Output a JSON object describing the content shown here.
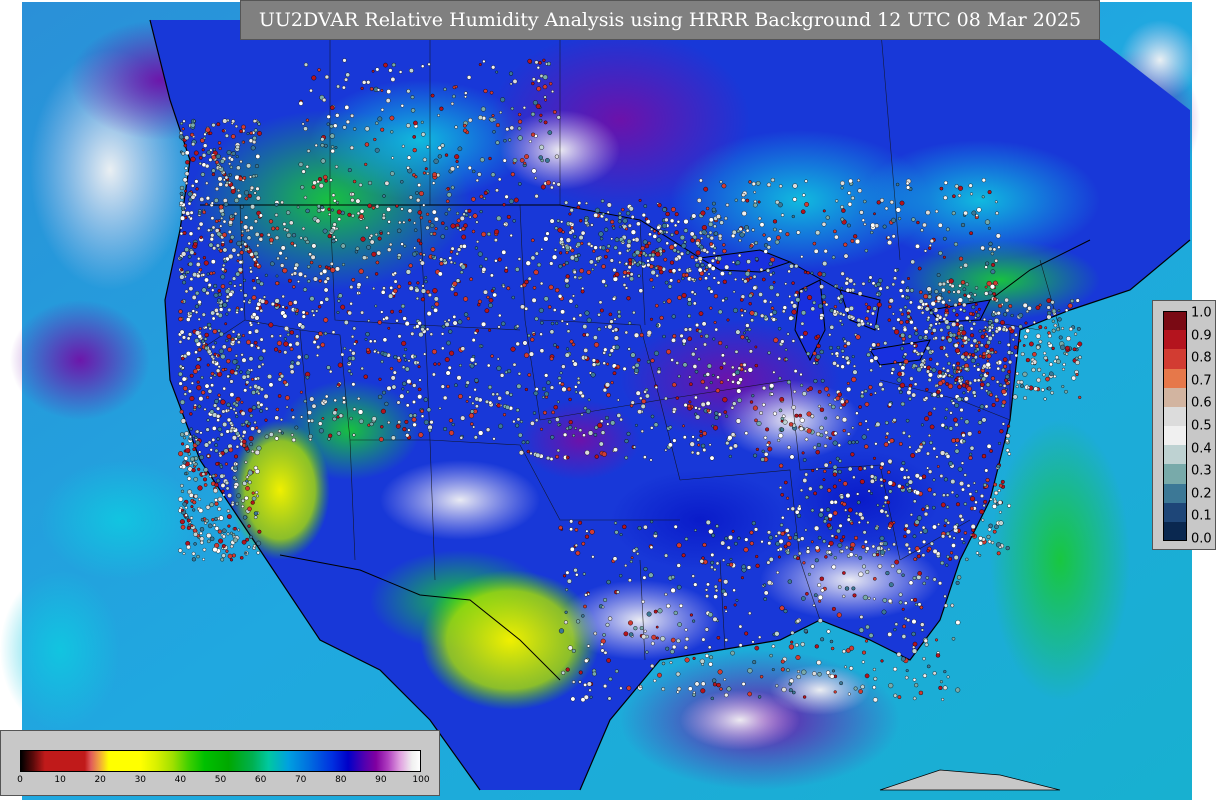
{
  "title": "UU2DVAR Relative Humidity Analysis using HRRR Background 12 UTC 08 Mar 2025",
  "bottom_colorbar": {
    "ticks": [
      "0",
      "10",
      "20",
      "30",
      "40",
      "50",
      "60",
      "70",
      "80",
      "90",
      "100"
    ],
    "min": 0,
    "max": 100
  },
  "right_legend": {
    "labels": [
      "1.0",
      "0.9",
      "0.8",
      "0.7",
      "0.6",
      "0.5",
      "0.4",
      "0.3",
      "0.2",
      "0.1",
      "0.0"
    ],
    "colors": [
      "#7a0a14",
      "#b4141e",
      "#d23c32",
      "#e6784a",
      "#d2b4a0",
      "#dcdcdc",
      "#f0f0f0",
      "#bed2d2",
      "#78aaaa",
      "#3c7896",
      "#1e4678",
      "#0a2850"
    ]
  },
  "colors": {
    "ocean_blue": "#2a9ad8",
    "ocean_cyan": "#18b8d8",
    "land_blue": "#1030d8",
    "land_green": "#18c838",
    "humid_purple": "#8020b0",
    "dry_yellow": "#f0f000",
    "out_of_domain_gray": "#c8c8c8"
  }
}
